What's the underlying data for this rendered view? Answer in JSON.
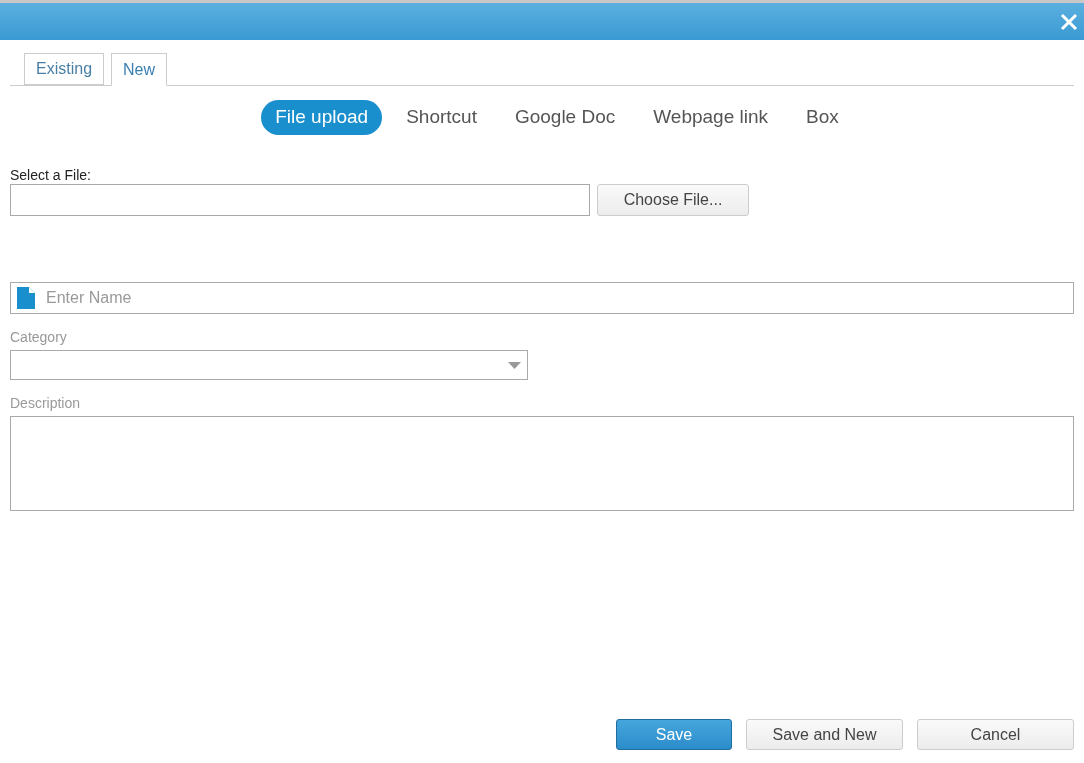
{
  "tabs": [
    {
      "label": "Existing",
      "selected": false
    },
    {
      "label": "New",
      "selected": true
    }
  ],
  "source_tabs": [
    {
      "label": "File upload",
      "selected": true
    },
    {
      "label": "Shortcut",
      "selected": false
    },
    {
      "label": "Google Doc",
      "selected": false
    },
    {
      "label": "Webpage link",
      "selected": false
    },
    {
      "label": "Box",
      "selected": false
    }
  ],
  "file": {
    "label": "Select a File:",
    "button": "Choose File..."
  },
  "name": {
    "placeholder": "Enter Name"
  },
  "category": {
    "label": "Category"
  },
  "description": {
    "label": "Description"
  },
  "buttons": [
    {
      "label": "Save",
      "kind": "primary"
    },
    {
      "label": "Save and New",
      "kind": "default"
    },
    {
      "label": "Cancel",
      "kind": "default"
    }
  ]
}
